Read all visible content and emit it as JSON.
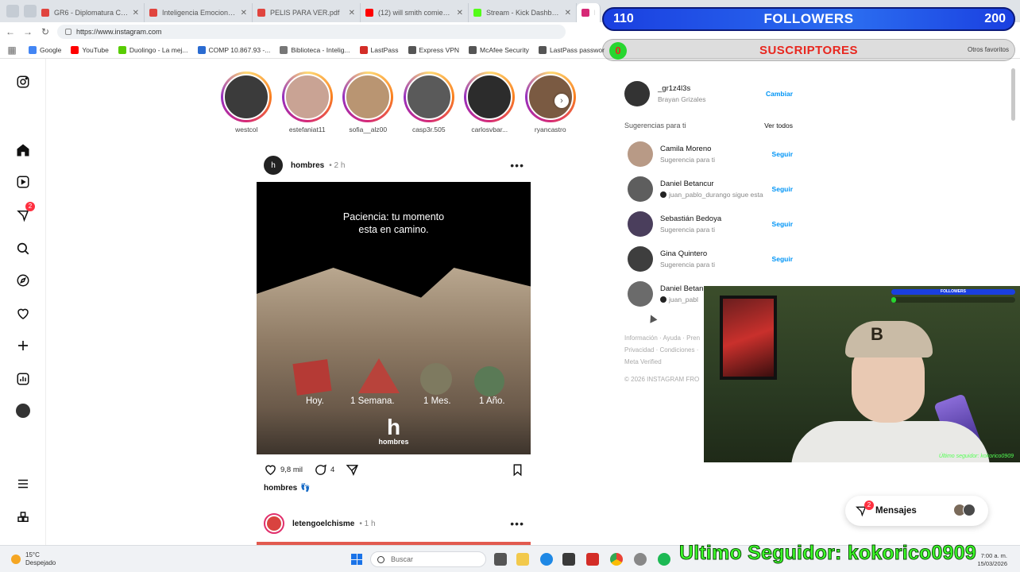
{
  "browser": {
    "tabs": [
      {
        "title": "GR6 - Diplomatura Coachi",
        "color": "#e0443e"
      },
      {
        "title": "Inteligencia Emocional GD",
        "color": "#e0443e"
      },
      {
        "title": "PELIS PARA VER.pdf",
        "color": "#e0443e"
      },
      {
        "title": "(12) will smith comiendo sp",
        "color": "#ff0000"
      },
      {
        "title": "Stream - Kick Dashboard",
        "color": "#53fc18"
      },
      {
        "title": "Ins",
        "color": "#d62976"
      }
    ],
    "url": "https://www.instagram.com",
    "bookmarks": [
      {
        "label": "Google",
        "color": "#4285f4"
      },
      {
        "label": "YouTube",
        "color": "#ff0000"
      },
      {
        "label": "Duolingo - La mej...",
        "color": "#58cc02"
      },
      {
        "label": "COMP 10.867.93 -...",
        "color": "#2a6bd1"
      },
      {
        "label": "Biblioteca - Intelig...",
        "color": "#777777"
      },
      {
        "label": "LastPass",
        "color": "#d32d27"
      },
      {
        "label": "Express VPN",
        "color": "#555555"
      },
      {
        "label": "McAfee Security",
        "color": "#555555"
      },
      {
        "label": "LastPass passwor",
        "color": "#555555"
      }
    ],
    "bookmarks_right": "Otros favoritos"
  },
  "stories": [
    {
      "user": "westcol",
      "color": "#3b3b3b"
    },
    {
      "user": "estefaniat11",
      "color": "#c9a394"
    },
    {
      "user": "sofia__alz00",
      "color": "#b99572"
    },
    {
      "user": "casp3r.505",
      "color": "#5a5a5a"
    },
    {
      "user": "carlosvbar...",
      "color": "#2c2c2c"
    },
    {
      "user": "ryancastro",
      "color": "#7a5a42"
    }
  ],
  "post": {
    "user": "hombres",
    "time": "• 2 h",
    "avatar_letter": "h",
    "quote_line1": "Paciencia: tu momento",
    "quote_line2": "esta en camino.",
    "labels": [
      "Hoy.",
      "1 Semana.",
      "1 Mes.",
      "1 Año."
    ],
    "logo_letter": "h",
    "logo_word": "hombres",
    "likes": "9,8 mil",
    "comments": "4",
    "caption_user": "hombres",
    "caption_emoji": "👣"
  },
  "post2": {
    "user": "letengoelchisme",
    "time": "• 1 h"
  },
  "sidebar": {
    "me_user": "_gr1z4l3s",
    "me_name": "Brayan Grizales",
    "switch_label": "Cambiar",
    "suggestions_title": "Sugerencias para ti",
    "see_all": "Ver todos",
    "suggestions": [
      {
        "name": "Camila Moreno",
        "sub": "Sugerencia para ti",
        "action": "Seguir",
        "dot": false
      },
      {
        "name": "Daniel Betancur",
        "sub": "juan_pablo_durango sigue esta",
        "action": "Seguir",
        "dot": true
      },
      {
        "name": "Sebastián Bedoya",
        "sub": "Sugerencia para ti",
        "action": "Seguir",
        "dot": false
      },
      {
        "name": "Gina Quintero",
        "sub": "Sugerencia para ti",
        "action": "Seguir",
        "dot": false
      },
      {
        "name": "Daniel Betan",
        "sub": "juan_pabl",
        "action": "",
        "dot": true
      }
    ],
    "footer_line1": "Información · Ayuda · Pren",
    "footer_line2": "Privacidad · Condiciones ·",
    "footer_line3": "Meta Verified",
    "copyright": "© 2026 INSTAGRAM FRO"
  },
  "nav": {
    "notif_count": "2"
  },
  "messages": {
    "label": "Mensajes",
    "badge": "2"
  },
  "overlay": {
    "followers_current": "110",
    "followers_label": "FOLLOWERS",
    "followers_goal": "200",
    "subs_current": "0",
    "subs_label": "SUSCRIPTORES",
    "last_follower": "Ultimo Seguidor: kokorico0909",
    "cam_tag": "Último seguidor: kokorico0909",
    "cam_mini_label": "FOLLOWERS"
  },
  "taskbar": {
    "temp": "15°C",
    "weather": "Despejado",
    "search": "Buscar",
    "time": "7:00 a. m.",
    "date": "15/03/2026"
  }
}
